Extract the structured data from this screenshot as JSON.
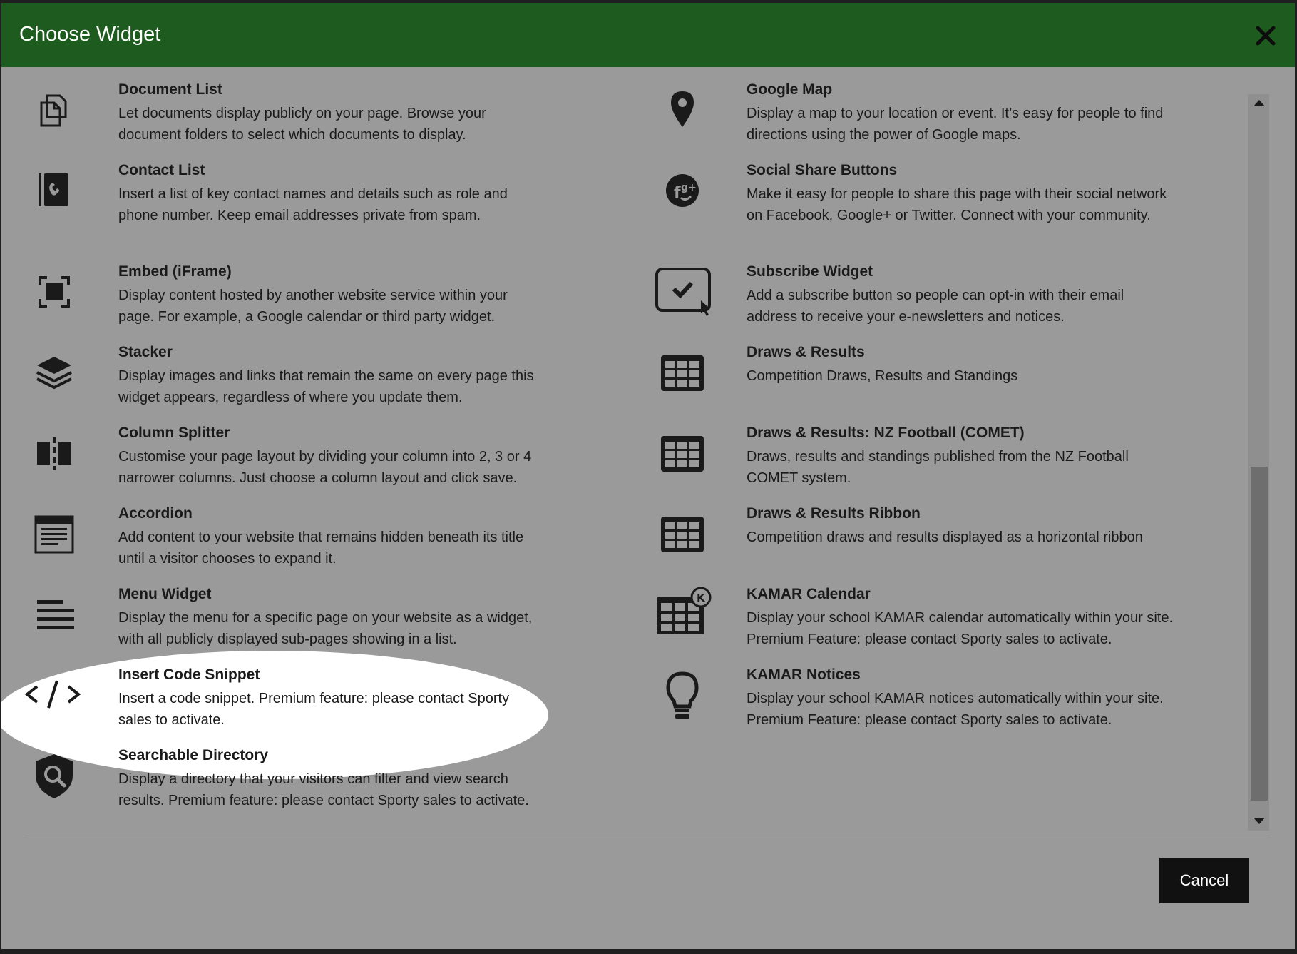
{
  "modal": {
    "title": "Choose Widget",
    "close_icon": "close-icon",
    "header_color": "#1e5b1e"
  },
  "widgets_left": [
    {
      "title": "Document List",
      "description": "Let documents display publicly on your page. Browse your document folders to select which documents to display.",
      "icon": "documents-icon"
    },
    {
      "title": "Contact List",
      "description": "Insert a list of key contact names and details such as role and phone number. Keep email addresses private from spam.",
      "icon": "contact-book-icon"
    },
    {
      "title": "Embed (iFrame)",
      "description": "Display content hosted by another website service within your page. For example, a Google calendar or third party widget.",
      "icon": "embed-frame-icon"
    },
    {
      "title": "Stacker",
      "description": "Display images and links that remain the same on every page this widget appears, regardless of where you update them.",
      "icon": "layers-icon"
    },
    {
      "title": "Column Splitter",
      "description": "Customise your page layout by dividing your column into 2, 3 or 4 narrower columns. Just choose a column layout and click save.",
      "icon": "column-split-icon"
    },
    {
      "title": "Accordion",
      "description": "Add content to your website that remains hidden beneath its title until a visitor chooses to expand it.",
      "icon": "accordion-icon"
    },
    {
      "title": "Menu Widget",
      "description": "Display the menu for a specific page on your website as a widget, with all publicly displayed sub-pages showing in a list.",
      "icon": "menu-lines-icon"
    },
    {
      "title": "Insert Code Snippet",
      "description": "Insert a code snippet. Premium feature: please contact Sporty sales to activate.",
      "icon": "code-icon"
    },
    {
      "title": "Searchable Directory",
      "description": "Display a directory that your visitors can filter and view search results. Premium feature: please contact Sporty sales to activate.",
      "icon": "search-shield-icon"
    }
  ],
  "widgets_right": [
    {
      "title": "Google Map",
      "description": "Display a map to your location or event. It’s easy for people to find directions using the power of Google maps.",
      "icon": "map-pin-icon"
    },
    {
      "title": "Social Share Buttons",
      "description": "Make it easy for people to share this page with their social network on Facebook, Google+ or Twitter. Connect with your community.",
      "icon": "social-share-icon"
    },
    {
      "title": "Subscribe Widget",
      "description": "Add a subscribe button so people can opt-in with their email address to receive your e-newsletters and notices.",
      "icon": "subscribe-check-icon"
    },
    {
      "title": "Draws & Results",
      "description": "Competition Draws, Results and Standings",
      "icon": "grid-table-icon"
    },
    {
      "title": "Draws & Results: NZ Football (COMET)",
      "description": "Draws, results and standings published from the NZ Football COMET system.",
      "icon": "grid-table-icon"
    },
    {
      "title": "Draws & Results Ribbon",
      "description": "Competition draws and results displayed as a horizontal ribbon",
      "icon": "grid-table-icon"
    },
    {
      "title": "KAMAR Calendar",
      "description": "Display your school KAMAR calendar automatically within your site. Premium Feature: please contact Sporty sales to activate.",
      "icon": "kamar-calendar-icon"
    },
    {
      "title": "KAMAR Notices",
      "description": "Display your school KAMAR notices automatically within your site. Premium Feature: please contact Sporty sales to activate.",
      "icon": "lightbulb-icon"
    }
  ],
  "footer": {
    "cancel_label": "Cancel"
  }
}
